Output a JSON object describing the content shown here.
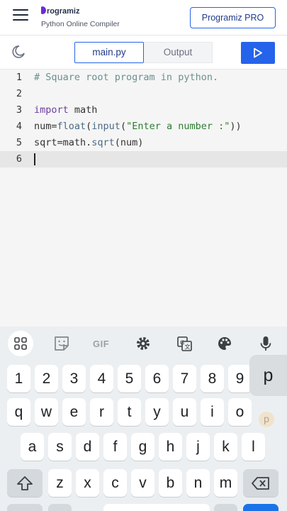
{
  "header": {
    "logo_text": "rogramiz",
    "subtitle": "Python Online Compiler",
    "pro_button": "Programiz PRO"
  },
  "toolbar": {
    "tabs": [
      {
        "label": "main.py",
        "active": true
      },
      {
        "label": "Output",
        "active": false
      }
    ],
    "run_icon": "play-icon",
    "theme_icon": "moon-icon"
  },
  "editor": {
    "file": "main.py",
    "lines": [
      {
        "number": "1",
        "text": "# Square root program in python."
      },
      {
        "number": "2",
        "text": ""
      },
      {
        "number": "3",
        "text": "import math"
      },
      {
        "number": "4",
        "text": "num=float(input(\"Enter a number :\"))"
      },
      {
        "number": "5",
        "text": "sqrt=math.sqrt(num)"
      },
      {
        "number": "6",
        "text": ""
      }
    ],
    "active_line": "6"
  },
  "keyboard": {
    "toolbar": {
      "items": [
        "apps-grid-icon",
        "sticker-icon",
        "GIF",
        "settings-icon",
        "translate-icon",
        "palette-icon",
        "microphone-icon"
      ],
      "gif_label": "GIF"
    },
    "rows": [
      [
        "1",
        "2",
        "3",
        "4",
        "5",
        "6",
        "7",
        "8",
        "9"
      ],
      [
        "q",
        "w",
        "e",
        "r",
        "t",
        "y",
        "u",
        "i",
        "o"
      ],
      [
        "a",
        "s",
        "d",
        "f",
        "g",
        "h",
        "j",
        "k",
        "l"
      ],
      [
        "shift",
        "z",
        "x",
        "c",
        "v",
        "b",
        "n",
        "m",
        "backspace"
      ]
    ],
    "key_popup": "p",
    "popup_ghost": "p"
  },
  "colors": {
    "accent": "#2563eb",
    "brand_purple": "#6c2bd9",
    "comment": "#6b8f8f",
    "keyword": "#6b3fa0",
    "string": "#2e7d32"
  }
}
